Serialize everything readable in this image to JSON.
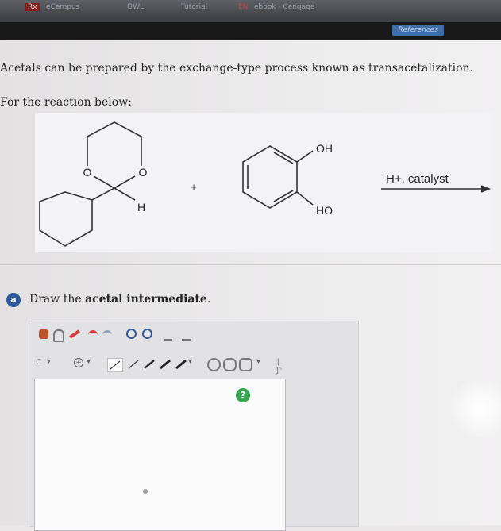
{
  "browser_bar": {
    "tabs": [
      {
        "label": "Rx"
      },
      {
        "label": "eCampus"
      },
      {
        "label": "OWL"
      },
      {
        "label": "Tutorial"
      },
      {
        "label": "EN"
      },
      {
        "label": "ebook - Cengage"
      }
    ]
  },
  "header": {
    "references_label": "References"
  },
  "question": {
    "intro": "Acetals can be prepared by the exchange-type process known as transacetalization.",
    "reaction_lead": "For the reaction below:"
  },
  "reaction": {
    "acetal_o_left": "O",
    "acetal_o_right": "O",
    "acetal_h": "H",
    "plus": "+",
    "diol_oh_top": "OH",
    "diol_oh_bottom": "HO",
    "conditions": "H+, catalyst"
  },
  "part_a": {
    "badge": "a",
    "prompt_prefix": "Draw the ",
    "prompt_bold": "acetal intermediate",
    "prompt_suffix": "."
  },
  "editor": {
    "toolbar_row1": [
      "hand-tool-icon",
      "lasso-icon",
      "erase-icon",
      "undo-icon",
      "redo-icon",
      "zoom-in-icon",
      "zoom-out-icon",
      "clean-icon",
      "template-icon"
    ],
    "toolbar_row2": [
      "element-c",
      "charge-plus",
      "single-bond",
      "dashed-bond",
      "wedge-bond",
      "hash-bond",
      "bond-menu",
      "benzene-ring",
      "cyclohexane-ring",
      "pentagon-ring",
      "ring-menu",
      "bracket-tool"
    ],
    "element_label": "C",
    "bracket_label": "[ ]ⁿ",
    "help_label": "?"
  }
}
